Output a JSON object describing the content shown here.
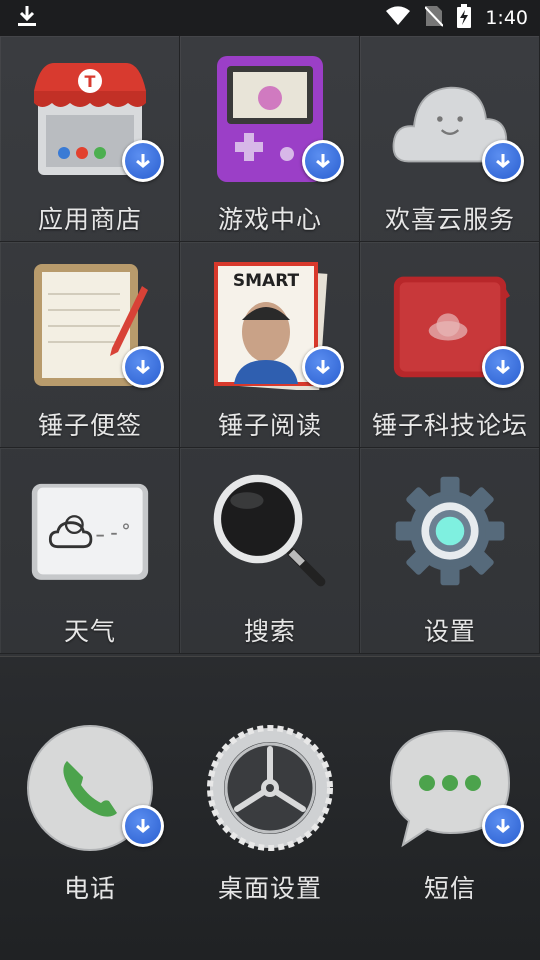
{
  "status_bar": {
    "time": "1:40",
    "icons": [
      "download-icon",
      "wifi-icon",
      "no-sim-icon",
      "battery-charging-icon"
    ]
  },
  "grid": {
    "apps": [
      {
        "label": "应用商店",
        "icon": "store-icon",
        "badge": "download-badge"
      },
      {
        "label": "游戏中心",
        "icon": "game-console-icon",
        "badge": "download-badge"
      },
      {
        "label": "欢喜云服务",
        "icon": "cloud-icon",
        "badge": "download-badge"
      },
      {
        "label": "锤子便签",
        "icon": "notepad-icon",
        "badge": "download-badge"
      },
      {
        "label": "锤子阅读",
        "icon": "magazine-icon",
        "badge": "download-badge",
        "cover_text": "SMART"
      },
      {
        "label": "锤子科技论坛",
        "icon": "forum-icon",
        "badge": "download-badge"
      },
      {
        "label": "天气",
        "icon": "weather-icon"
      },
      {
        "label": "搜索",
        "icon": "magnifier-icon"
      },
      {
        "label": "设置",
        "icon": "settings-gear-icon"
      }
    ]
  },
  "dock": {
    "apps": [
      {
        "label": "电话",
        "icon": "phone-icon",
        "badge": "download-badge"
      },
      {
        "label": "桌面设置",
        "icon": "desktop-settings-icon"
      },
      {
        "label": "短信",
        "icon": "messages-icon",
        "badge": "download-badge"
      }
    ]
  },
  "colors": {
    "badge": "#2a5fd0",
    "background": "#2e3033",
    "status_bar": "#1c1d1f"
  }
}
